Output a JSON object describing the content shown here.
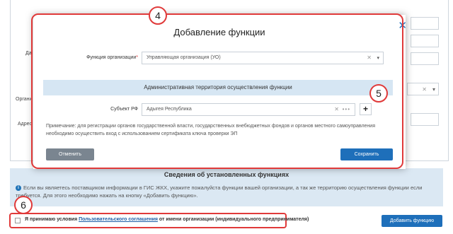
{
  "background": {
    "labels": [
      "Да",
      "Органи",
      "Адрес"
    ],
    "info_panel": {
      "title": "Сведения об установленных функциях",
      "text": "Если вы являетесь поставщиком информации в ГИС ЖКХ, укажите пожалуйста функции вашей организации, а так же территорию осуществления функции если требуется. Для этого необходимо нажать на кнопку «Добавить функцию»."
    },
    "agreement": {
      "prefix": "Я принимаю условия",
      "link": "Пользовательского соглашения",
      "suffix": "от имени организации (индивидуального предпринимателя)"
    },
    "add_function_button": "Добавить функцию"
  },
  "modal": {
    "title": "Добавление функции",
    "close_icon": "close-icon",
    "org_function_label": "Функция организации",
    "required_mark": "*",
    "org_function_value": "Управляющая организация (УО)",
    "section_title": "Административная территория осуществления функции",
    "subject_label": "Субъект РФ",
    "subject_value": "Адыгея Республика",
    "subject_dots": "•••",
    "plus_label": "+",
    "note": "Примечание: для регистрации органов государственной власти, государственных внебюджетных фондов и органов местного самоуправления необходимо осуществить вход с использованием сертификата ключа проверки ЭП",
    "cancel_button": "Отменить",
    "save_button": "Сохранить"
  },
  "callouts": {
    "c4": "4",
    "c5": "5",
    "c6": "6"
  },
  "colors": {
    "accent_blue": "#1e6fba",
    "highlight_red": "#e03a3a",
    "section_blue": "#d6e6f3"
  }
}
